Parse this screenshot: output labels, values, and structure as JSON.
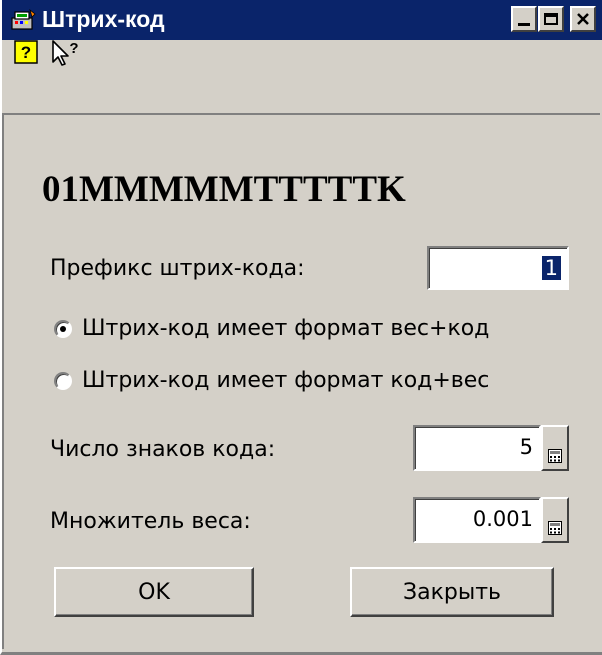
{
  "window": {
    "title": "Штрих-код"
  },
  "toolbar": {
    "help_icon": "help-question-icon",
    "whatsthis_icon": "whats-this-pointer-icon"
  },
  "form": {
    "format_title": "01MMMMMTTTTTK",
    "prefix_label": "Префикс штрих-кода:",
    "prefix_value": "1",
    "radio_options": [
      {
        "label": "Штрих-код имеет формат вес+код",
        "checked": true
      },
      {
        "label": "Штрих-код имеет формат код+вес",
        "checked": false
      }
    ],
    "digits_label": "Число знаков кода:",
    "digits_value": "5",
    "weight_label": "Множитель веса:",
    "weight_value": "0.001"
  },
  "buttons": {
    "ok_label": "OK",
    "close_label": "Закрыть"
  },
  "colors": {
    "titlebar": "#0a246a",
    "face": "#d4d0c8",
    "selection": "#0a246a"
  }
}
